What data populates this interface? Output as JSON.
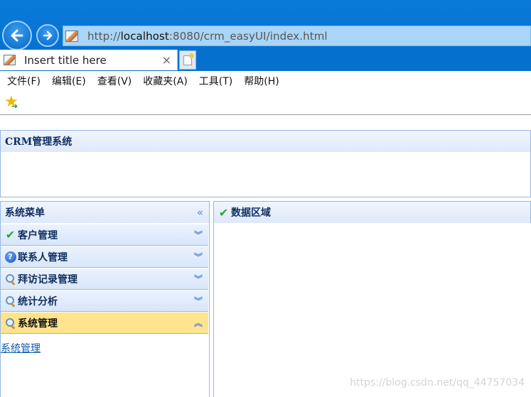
{
  "browser": {
    "url_prefix": "http://",
    "url_host": "localhost",
    "url_rest": ":8080/crm_easyUI/index.html",
    "tab_title": "Insert title here",
    "tab_close": "×",
    "back_icon": "arrow-left-icon",
    "forward_icon": "arrow-right-icon"
  },
  "menubar": {
    "items": [
      "文件(F)",
      "编辑(E)",
      "查看(V)",
      "收藏夹(A)",
      "工具(T)",
      "帮助(H)"
    ]
  },
  "layout": {
    "north_title": "CRM管理系统",
    "west_title": "系统菜单",
    "center_title": "数据区域"
  },
  "accordion": {
    "items": [
      {
        "label": "客户管理",
        "icon": "check-icon",
        "expanded": false
      },
      {
        "label": "联系人管理",
        "icon": "help-icon",
        "expanded": false
      },
      {
        "label": "拜访记录管理",
        "icon": "search-icon",
        "expanded": false
      },
      {
        "label": "统计分析",
        "icon": "search-icon",
        "expanded": false
      },
      {
        "label": "系统管理",
        "icon": "search-icon",
        "expanded": true
      }
    ],
    "expanded_links": [
      "系统管理"
    ]
  },
  "watermark": "https://blog.csdn.net/qq_44757034",
  "colors": {
    "chrome_blue": "#0572d2",
    "panel_border": "#95b8e7",
    "panel_title": "#0e2d5f",
    "selected_accordion": "#ffe48d"
  }
}
